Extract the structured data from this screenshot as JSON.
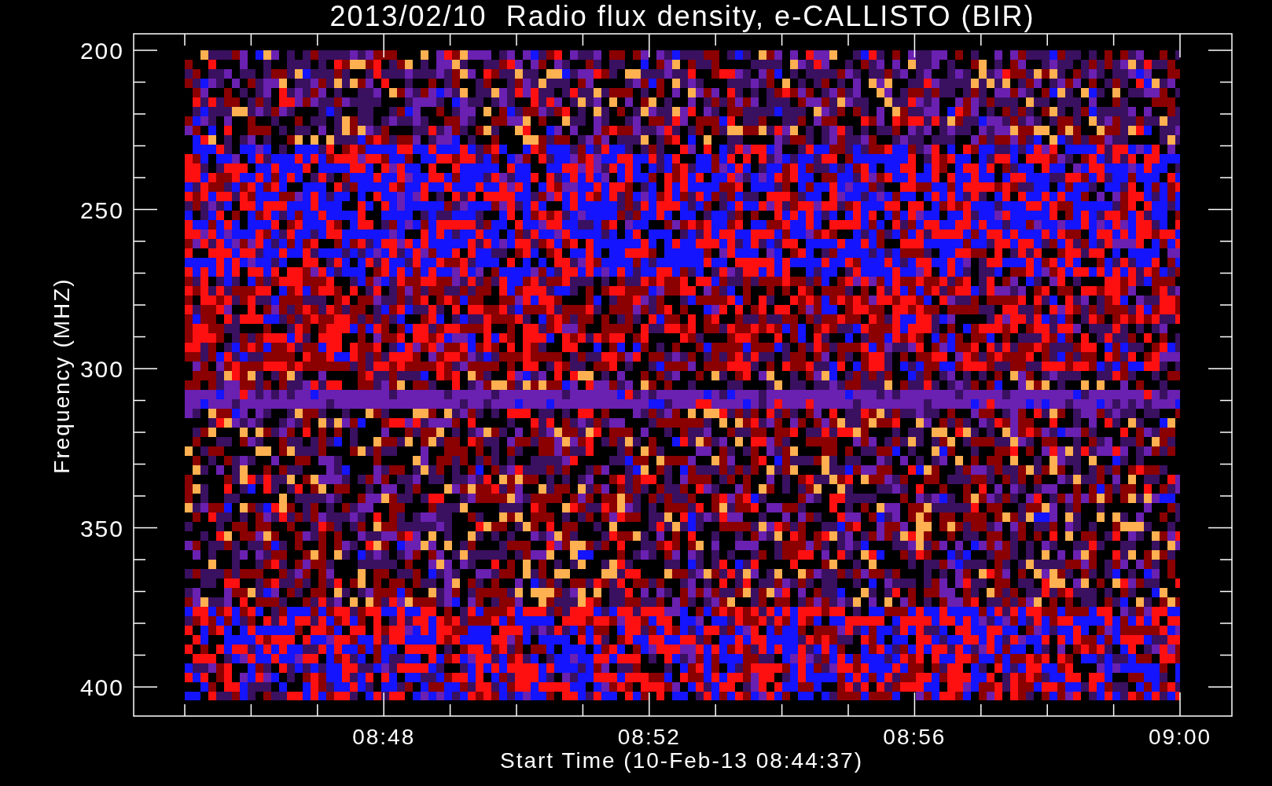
{
  "plot": {
    "title": "2013/02/10  Radio flux density, e-CALLISTO (BIR)",
    "xlabel": "Start Time (10-Feb-13 08:44:37)",
    "ylabel": "Frequency (MHZ)",
    "xticks": [
      "08:48",
      "08:52",
      "08:56",
      "09:00"
    ],
    "yticks": [
      "200",
      "250",
      "300",
      "350",
      "400"
    ]
  }
}
